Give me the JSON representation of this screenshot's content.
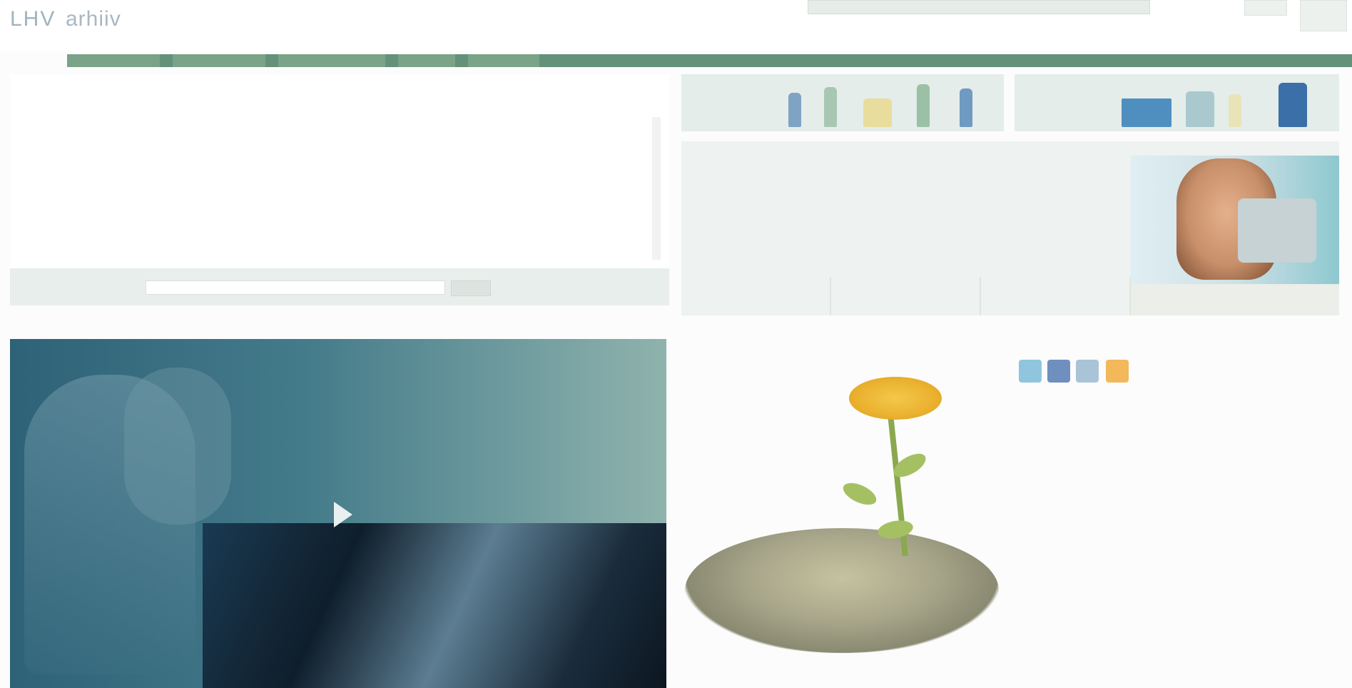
{
  "header": {
    "logo_main": "LHV",
    "logo_second": "arhiiv",
    "logo_sub": "",
    "search_placeholder": "",
    "top_buttons": [
      "",
      ""
    ],
    "lang_link": "",
    "login_link": ""
  },
  "nav": {
    "home_label": "",
    "items": [
      "",
      "",
      "",
      "",
      ""
    ]
  },
  "left": {
    "title": "",
    "subtitle": "",
    "subtitle_link": "",
    "list": [
      "",
      "",
      "",
      "",
      "",
      "",
      ""
    ]
  },
  "search_strip": {
    "label": "",
    "button": ""
  },
  "video": {
    "title": "",
    "caption": ""
  },
  "banners": [
    {
      "text": ""
    },
    {
      "text": ""
    }
  ],
  "news": {
    "title": "",
    "headline": "",
    "body": "",
    "tabs": [
      "",
      "",
      ""
    ],
    "photo_caption": ""
  },
  "savings": {
    "title": "",
    "caption": ""
  },
  "follow": {
    "title": "",
    "icons": [
      "twitter-icon",
      "facebook-icon",
      "email-icon",
      "rss-icon"
    ]
  },
  "section2": {
    "title": "",
    "text": "",
    "list": [
      "",
      "",
      "",
      ""
    ]
  },
  "section3": {
    "title": "",
    "list": [
      "",
      "",
      ""
    ],
    "link": ""
  },
  "colors": {
    "nav_green": "#63917a",
    "gold_text": "#c4b25a",
    "link_blue": "#7aa3bd"
  }
}
